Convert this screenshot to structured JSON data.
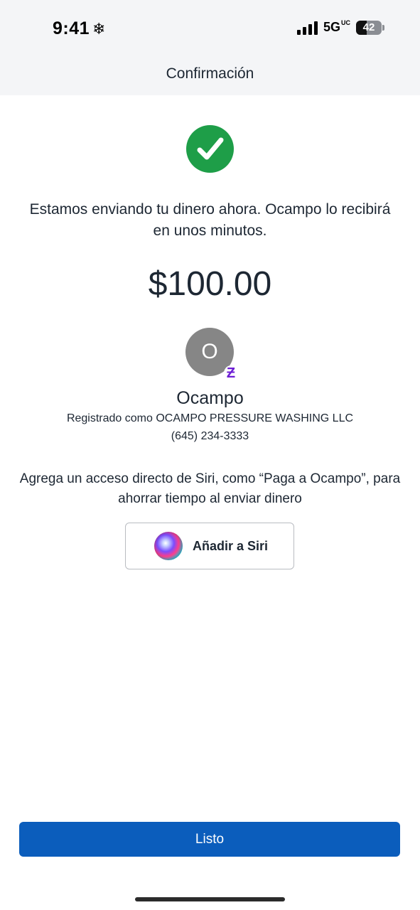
{
  "status_bar": {
    "time": "9:41",
    "focus_icon": "snowflake-icon",
    "network": "5G",
    "network_suffix": "UC",
    "battery": "42"
  },
  "header": {
    "title": "Confirmación"
  },
  "confirmation": {
    "icon": "checkmark-circle-icon",
    "message": "Estamos enviando tu dinero ahora. Ocampo lo recibirá en unos minutos.",
    "amount": "$100.00"
  },
  "recipient": {
    "initial": "O",
    "name": "Ocampo",
    "registered_as": "Registrado como OCAMPO PRESSURE WASHING LLC",
    "phone": "(645) 234-3333",
    "badge_glyph": "Ƶ"
  },
  "siri": {
    "description": "Agrega un acceso directo de Siri, como “Paga a Ocampo”, para ahorrar tiempo al enviar dinero",
    "button_label": "Añadir a Siri"
  },
  "footer": {
    "done_label": "Listo"
  },
  "colors": {
    "success": "#1e9e48",
    "primary": "#0b5dbc",
    "zelle": "#6d1ed4"
  }
}
